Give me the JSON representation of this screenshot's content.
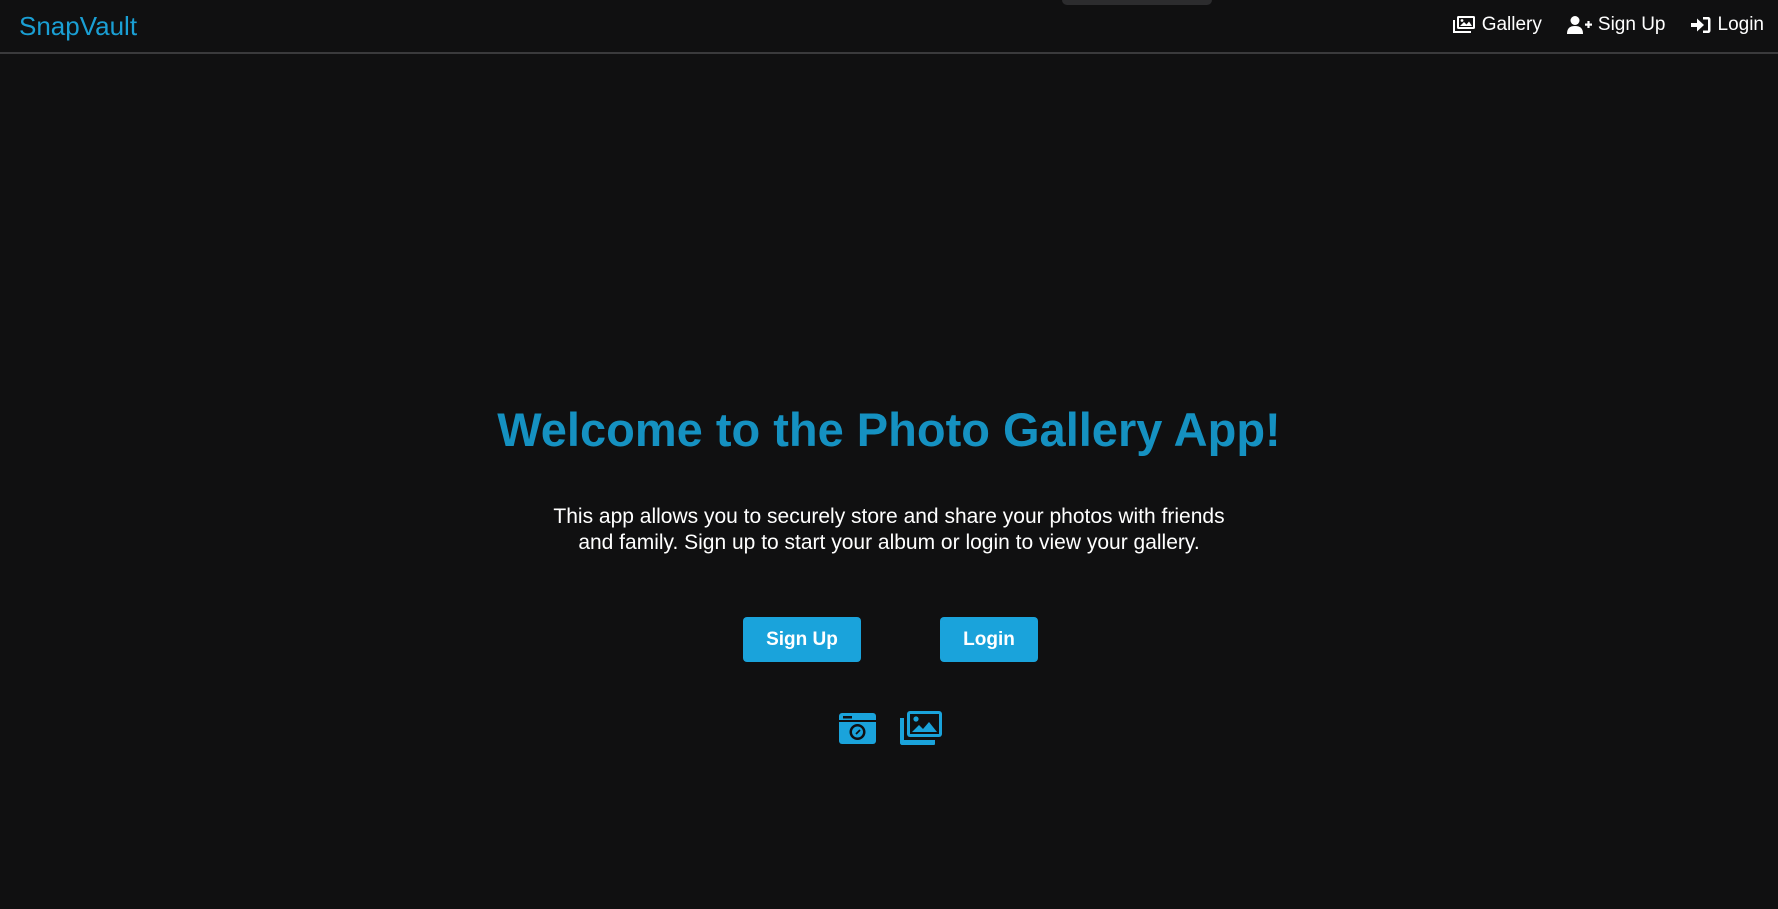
{
  "navbar": {
    "brand": "SnapVault",
    "links": [
      {
        "label": "Gallery",
        "icon": "images-icon"
      },
      {
        "label": "Sign Up",
        "icon": "user-plus-icon"
      },
      {
        "label": "Login",
        "icon": "sign-in-icon"
      }
    ]
  },
  "hero": {
    "title": "Welcome to the Photo Gallery App!",
    "description": "This app allows you to securely store and share your photos with friends and family. Sign up to start your album or login to view your gallery.",
    "signup_label": "Sign Up",
    "login_label": "Login",
    "icons": [
      "camera-icon",
      "images-icon"
    ]
  },
  "colors": {
    "background": "#101011",
    "brand": "#1a9fd4",
    "title": "#1591c1",
    "button": "#1aa3db",
    "text": "#ffffff"
  }
}
